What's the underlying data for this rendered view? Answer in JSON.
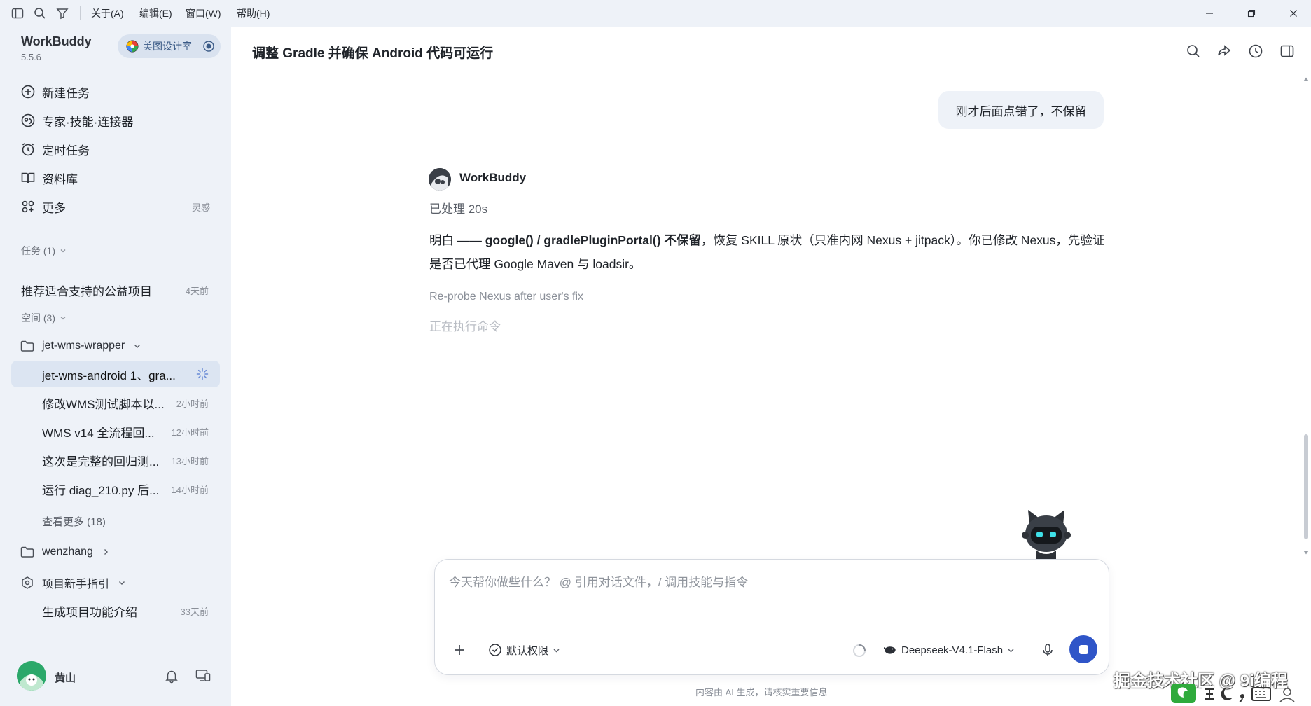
{
  "titlebar": {
    "menus": [
      "关于(A)",
      "编辑(E)",
      "窗口(W)",
      "帮助(H)"
    ]
  },
  "sidebar": {
    "brand": "WorkBuddy",
    "version": "5.5.6",
    "org_name": "美图设计室",
    "nav": {
      "new_task": "新建任务",
      "experts": "专家·技能·连接器",
      "scheduled": "定时任务",
      "library": "资料库",
      "more": "更多",
      "more_note": "灵感"
    },
    "tasks_header": "任务 (1)",
    "tasks": [
      {
        "title": "推荐适合支持的公益项目",
        "time": "4天前"
      }
    ],
    "spaces_header": "空间 (3)",
    "space1": {
      "name": "jet-wms-wrapper",
      "items": [
        {
          "title": "jet-wms-android 1、gra...",
          "time": ""
        },
        {
          "title": "修改WMS测试脚本以...",
          "time": "2小时前"
        },
        {
          "title": "WMS v14 全流程回...",
          "time": "12小时前"
        },
        {
          "title": "这次是完整的回归测...",
          "time": "13小时前"
        },
        {
          "title": "运行 diag_210.py 后...",
          "time": "14小时前"
        }
      ],
      "see_more": "查看更多 (18)"
    },
    "space2": {
      "name": "wenzhang"
    },
    "space3": {
      "name": "项目新手指引",
      "items": [
        {
          "title": "生成项目功能介绍",
          "time": "33天前"
        }
      ]
    },
    "user": {
      "name": "黄山"
    }
  },
  "main": {
    "title": "调整 Gradle 并确保 Android 代码可运行",
    "user_message": "刚才后面点错了，不保留",
    "bot_name": "WorkBuddy",
    "processed": "已处理 20s",
    "reply": {
      "p1": "明白 —— ",
      "b1": "google() / gradlePluginPortal() 不保留",
      "p2": "，恢复 SKILL 原状（只准内网 Nexus + jitpack）。你已修改 Nexus，先验证是否已代理 Google Maven 与 loadsir。"
    },
    "step1": "Re-probe Nexus after user's fix",
    "step2": "正在执行命令"
  },
  "composer": {
    "placeholder": "今天帮你做些什么？ @ 引用对话文件，/ 调用技能与指令",
    "permission": "默认权限",
    "model": "Deepseek-V4.1-Flash"
  },
  "disclaimer": "内容由 AI 生成，请核实重要信息",
  "watermark": "掘金技术社区 @ 9i编程",
  "colors": {
    "sidebar_bg": "#eef2f8",
    "active_row": "#dce5f2",
    "send_button": "#2f55c8",
    "user_bubble": "#eef2f8"
  }
}
